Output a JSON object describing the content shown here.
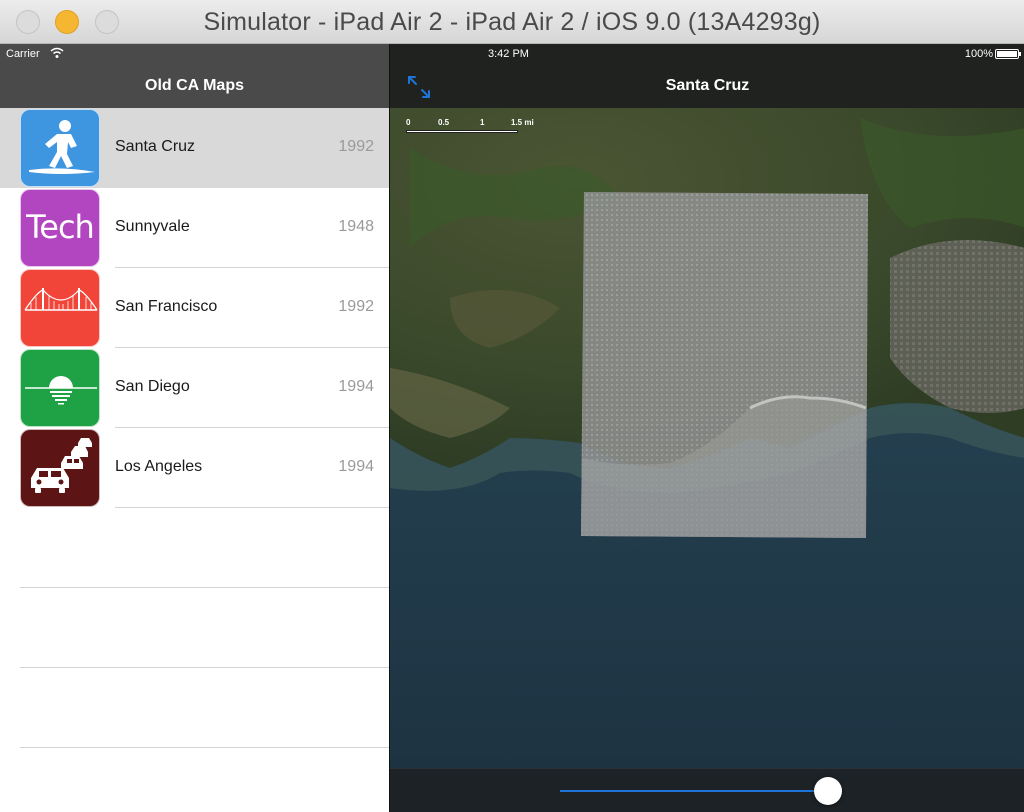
{
  "window": {
    "title": "Simulator - iPad Air 2 - iPad Air 2 / iOS 9.0 (13A4293g)"
  },
  "status_bar": {
    "carrier": "Carrier",
    "time": "3:42 PM",
    "battery": "100%"
  },
  "sidebar": {
    "title": "Old CA Maps",
    "items": [
      {
        "name": "Santa Cruz",
        "year": "1992",
        "icon": "surfer-icon",
        "color": "#3e95e0",
        "selected": true
      },
      {
        "name": "Sunnyvale",
        "year": "1948",
        "icon": "tech-icon",
        "icon_text": "Tech",
        "color": "#b245c0",
        "selected": false
      },
      {
        "name": "San Francisco",
        "year": "1992",
        "icon": "golden-gate-icon",
        "color": "#f2453a",
        "selected": false
      },
      {
        "name": "San Diego",
        "year": "1994",
        "icon": "sunset-icon",
        "color": "#1fa145",
        "selected": false
      },
      {
        "name": "Los Angeles",
        "year": "1994",
        "icon": "traffic-cars-icon",
        "color": "#5c1414",
        "selected": false
      }
    ]
  },
  "detail": {
    "title": "Santa Cruz",
    "scale_labels": [
      "0",
      "0.5",
      "1",
      "1.5 mi"
    ],
    "overlay_opacity": 0.8
  },
  "colors": {
    "nav_dark": "#4a4a4a",
    "accent": "#1e74d8"
  }
}
